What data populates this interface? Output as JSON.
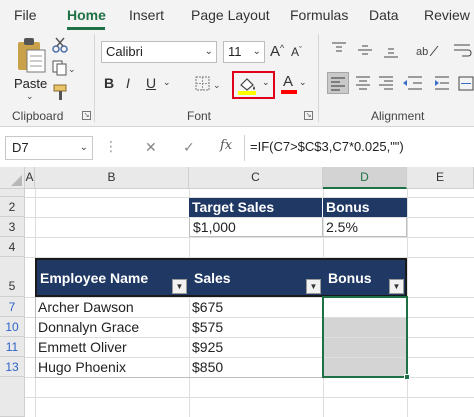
{
  "ribbon": {
    "tabs": [
      "File",
      "Home",
      "Insert",
      "Page Layout",
      "Formulas",
      "Data",
      "Review"
    ],
    "active_tab": "Home",
    "clipboard": {
      "paste_label": "Paste",
      "group_label": "Clipboard"
    },
    "font": {
      "name": "Calibri",
      "size": "11",
      "group_label": "Font",
      "bold": "B",
      "italic": "I",
      "underline": "U",
      "grow": "A",
      "shrink": "A",
      "font_color_letter": "A",
      "fill_color": "#ffff00",
      "font_color": "#ff0000",
      "highlight_border": "#e0001a"
    },
    "alignment": {
      "group_label": "Alignment"
    }
  },
  "formula_bar": {
    "name_box": "D7",
    "fx": "fx",
    "cancel": "✕",
    "confirm": "✓",
    "formula": "=IF(C7>$C$3,C7*0.025,\"\")"
  },
  "columns": [
    "A",
    "B",
    "C",
    "D",
    "E"
  ],
  "rows": [
    "2",
    "3",
    "4",
    "5",
    "7",
    "10",
    "11",
    "13"
  ],
  "targets": {
    "header_sales": "Target Sales",
    "header_bonus": "Bonus",
    "value_sales": "$1,000",
    "value_bonus": "2.5%"
  },
  "table": {
    "headers": [
      "Employee Name",
      "Sales",
      "Bonus"
    ],
    "rows": [
      {
        "name": "Archer Dawson",
        "sales": "$675"
      },
      {
        "name": "Donnalyn Grace",
        "sales": "$575"
      },
      {
        "name": "Emmett Oliver",
        "sales": "$925"
      },
      {
        "name": "Hugo Phoenix",
        "sales": "$850"
      }
    ]
  },
  "colors": {
    "accent": "#1e7145",
    "header_fill": "#203864",
    "selection_fill": "#d4d4d4"
  }
}
